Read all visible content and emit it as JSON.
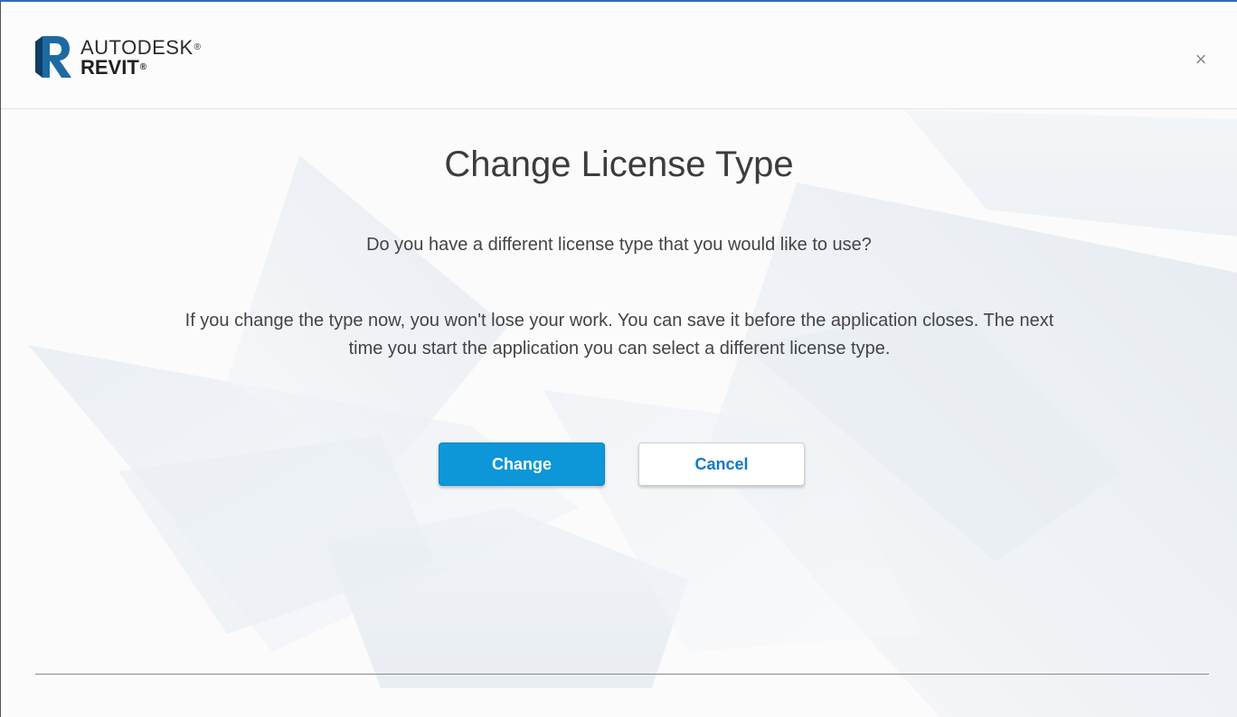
{
  "header": {
    "brand_line1": "AUTODESK",
    "brand_line2": "REVIT",
    "registered_mark": "®",
    "logo_icon": "revit-r-logo-icon",
    "close_icon": "close-icon",
    "close_glyph": "×"
  },
  "dialog": {
    "title": "Change License Type",
    "question": "Do you have a different license type that you would like to use?",
    "body": "If you change the type now, you won't lose your work. You can save it before the application closes. The next time you start the application you can select a different license type."
  },
  "buttons": {
    "change_label": "Change",
    "cancel_label": "Cancel"
  },
  "colors": {
    "accent": "#0d96d8",
    "link_blue": "#1577c7",
    "title_text": "#3c3c3c",
    "body_text": "#444444",
    "window_border_top": "#2e6db4"
  }
}
